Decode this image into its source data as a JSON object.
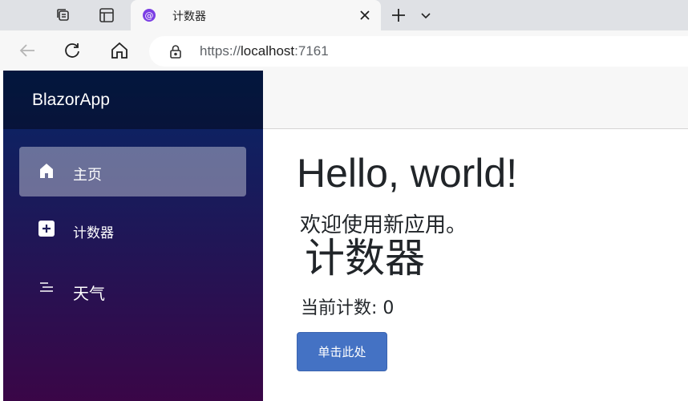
{
  "browser": {
    "tab": {
      "title": "计数器"
    },
    "address": {
      "scheme": "https://",
      "host": "localhost",
      "port": ":7161"
    }
  },
  "sidebar": {
    "brand": "BlazorApp",
    "items": [
      {
        "label": "主页",
        "icon": "home-icon",
        "active": true
      },
      {
        "label": "计数器",
        "icon": "plus-square-icon",
        "active": false
      },
      {
        "label": "天气",
        "icon": "list-icon",
        "active": false
      }
    ]
  },
  "main": {
    "heading": "Hello, world!",
    "welcome": "欢迎使用新应用。",
    "counter_title": "计数器",
    "count_text": "当前计数: 0",
    "button_label": "单击此处"
  },
  "colors": {
    "sidebar_gradient_top": "#052767",
    "sidebar_gradient_bottom": "#3a0647",
    "button_primary": "#4472c4"
  }
}
